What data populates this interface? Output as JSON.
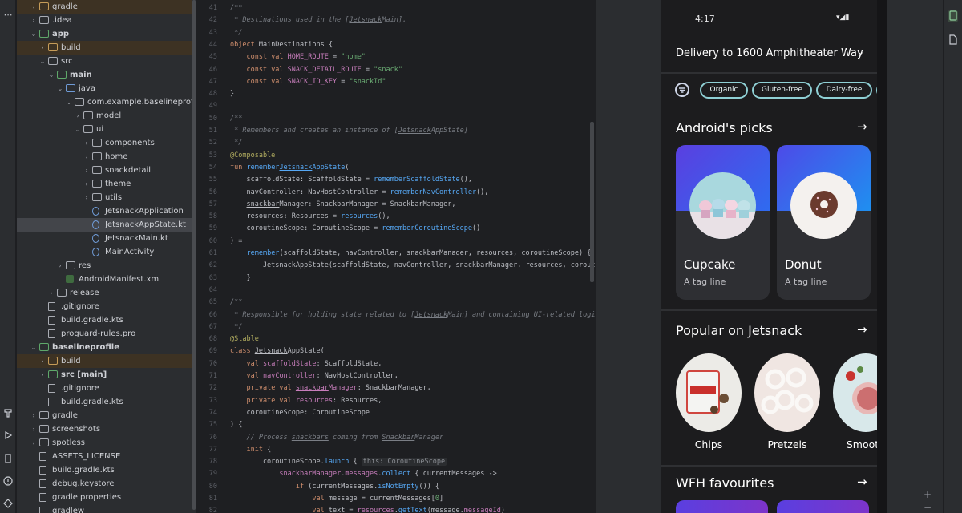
{
  "left_toolbar": {
    "more_label": "⋯",
    "icons": [
      "build-icon",
      "run-icon",
      "device-icon",
      "problems-icon",
      "git-icon"
    ]
  },
  "project_tree": {
    "items": [
      {
        "label": "gradle",
        "depth": 1,
        "chevron": "›",
        "icon": "folder-orange",
        "style": "excluded"
      },
      {
        "label": ".idea",
        "depth": 1,
        "chevron": "›",
        "icon": "folder"
      },
      {
        "label": "app",
        "depth": 1,
        "chevron": "⌄",
        "icon": "folder-green",
        "bold": true
      },
      {
        "label": "build",
        "depth": 2,
        "chevron": "›",
        "icon": "folder-orange",
        "style": "excluded"
      },
      {
        "label": "src",
        "depth": 2,
        "chevron": "⌄",
        "icon": "folder"
      },
      {
        "label": "main",
        "depth": 3,
        "chevron": "⌄",
        "icon": "folder-green",
        "bold": true
      },
      {
        "label": "java",
        "depth": 4,
        "chevron": "⌄",
        "icon": "folder-blue"
      },
      {
        "label": "com.example.baselineprofiles_codel",
        "depth": 5,
        "chevron": "⌄",
        "icon": "folder"
      },
      {
        "label": "model",
        "depth": 6,
        "chevron": "›",
        "icon": "folder"
      },
      {
        "label": "ui",
        "depth": 6,
        "chevron": "⌄",
        "icon": "folder"
      },
      {
        "label": "components",
        "depth": 7,
        "chevron": "›",
        "icon": "folder"
      },
      {
        "label": "home",
        "depth": 7,
        "chevron": "›",
        "icon": "folder"
      },
      {
        "label": "snackdetail",
        "depth": 7,
        "chevron": "›",
        "icon": "folder"
      },
      {
        "label": "theme",
        "depth": 7,
        "chevron": "›",
        "icon": "folder"
      },
      {
        "label": "utils",
        "depth": 7,
        "chevron": "›",
        "icon": "folder"
      },
      {
        "label": "JetsnackApplication",
        "depth": 7,
        "chevron": "",
        "icon": "kt"
      },
      {
        "label": "JetsnackAppState.kt",
        "depth": 7,
        "chevron": "",
        "icon": "kt",
        "style": "selected"
      },
      {
        "label": "JetsnackMain.kt",
        "depth": 7,
        "chevron": "",
        "icon": "kt"
      },
      {
        "label": "MainActivity",
        "depth": 7,
        "chevron": "",
        "icon": "kt"
      },
      {
        "label": "res",
        "depth": 4,
        "chevron": "›",
        "icon": "folder"
      },
      {
        "label": "AndroidManifest.xml",
        "depth": 4,
        "chevron": "",
        "icon": "xml"
      },
      {
        "label": "release",
        "depth": 3,
        "chevron": "›",
        "icon": "folder"
      },
      {
        "label": ".gitignore",
        "depth": 2,
        "chevron": "",
        "icon": "file"
      },
      {
        "label": "build.gradle.kts",
        "depth": 2,
        "chevron": "",
        "icon": "file"
      },
      {
        "label": "proguard-rules.pro",
        "depth": 2,
        "chevron": "",
        "icon": "file"
      },
      {
        "label": "baselineprofile",
        "depth": 1,
        "chevron": "⌄",
        "icon": "folder-green",
        "bold": true
      },
      {
        "label": "build",
        "depth": 2,
        "chevron": "›",
        "icon": "folder-orange",
        "style": "excluded"
      },
      {
        "label": "src [main]",
        "depth": 2,
        "chevron": "›",
        "icon": "folder-green",
        "bold": true
      },
      {
        "label": ".gitignore",
        "depth": 2,
        "chevron": "",
        "icon": "file"
      },
      {
        "label": "build.gradle.kts",
        "depth": 2,
        "chevron": "",
        "icon": "file"
      },
      {
        "label": "gradle",
        "depth": 1,
        "chevron": "›",
        "icon": "folder"
      },
      {
        "label": "screenshots",
        "depth": 1,
        "chevron": "›",
        "icon": "folder"
      },
      {
        "label": "spotless",
        "depth": 1,
        "chevron": "›",
        "icon": "folder"
      },
      {
        "label": "ASSETS_LICENSE",
        "depth": 1,
        "chevron": "",
        "icon": "file"
      },
      {
        "label": "build.gradle.kts",
        "depth": 1,
        "chevron": "",
        "icon": "file"
      },
      {
        "label": "debug.keystore",
        "depth": 1,
        "chevron": "",
        "icon": "file"
      },
      {
        "label": "gradle.properties",
        "depth": 1,
        "chevron": "",
        "icon": "file"
      },
      {
        "label": "gradlew",
        "depth": 1,
        "chevron": "",
        "icon": "file"
      }
    ]
  },
  "editor": {
    "lines": [
      {
        "n": "41",
        "html": "<span class=\"c-com\">/**</span>"
      },
      {
        "n": "42",
        "html": "<span class=\"c-com\"> * Destinations used in the [<span class=\"c-ul\">Jetsnack</span>Main].</span>"
      },
      {
        "n": "43",
        "html": "<span class=\"c-com\"> */</span>"
      },
      {
        "n": "44",
        "html": "<span class=\"c-kw\">object</span> MainDestinations {"
      },
      {
        "n": "45",
        "html": "    <span class=\"c-kw\">const val</span> <span class=\"c-prop\">HOME_ROUTE</span> = <span class=\"c-str\">\"home\"</span>"
      },
      {
        "n": "46",
        "html": "    <span class=\"c-kw\">const val</span> <span class=\"c-prop\">SNACK_DETAIL_ROUTE</span> = <span class=\"c-str\">\"snack\"</span>"
      },
      {
        "n": "47",
        "html": "    <span class=\"c-kw\">const val</span> <span class=\"c-prop\">SNACK_ID_KEY</span> = <span class=\"c-str\">\"snackId\"</span>"
      },
      {
        "n": "48",
        "html": "}"
      },
      {
        "n": "49",
        "html": ""
      },
      {
        "n": "50",
        "html": "<span class=\"c-com\">/**</span>"
      },
      {
        "n": "51",
        "html": "<span class=\"c-com\"> * Remembers and creates an instance of [<span class=\"c-ul\">Jetsnack</span>AppState]</span>"
      },
      {
        "n": "52",
        "html": "<span class=\"c-com\"> */</span>"
      },
      {
        "n": "53",
        "html": "<span class=\"c-ann\">@Composable</span>"
      },
      {
        "n": "54",
        "html": "<span class=\"c-kw\">fun</span> <span class=\"c-fn\">remember<span class=\"c-ul\">Jetsnack</span>AppState</span>("
      },
      {
        "n": "55",
        "html": "    scaffoldState: ScaffoldState = <span class=\"c-fn\">rememberScaffoldState</span>(),"
      },
      {
        "n": "56",
        "html": "    navController: NavHostController = <span class=\"c-fn\">rememberNavController</span>(),"
      },
      {
        "n": "57",
        "html": "    <span class=\"c-ul\">snackbar</span>Manager: SnackbarManager = SnackbarManager,"
      },
      {
        "n": "58",
        "html": "    resources: Resources = <span class=\"c-fn\">resources</span>(),"
      },
      {
        "n": "59",
        "html": "    coroutineScope: CoroutineScope = <span class=\"c-fn\">rememberCoroutineScope</span>()"
      },
      {
        "n": "60",
        "html": ") ="
      },
      {
        "n": "61",
        "html": "    <span class=\"c-fn\">remember</span>(scaffoldState, navController, snackbarManager, resources, coroutineScope) {"
      },
      {
        "n": "62",
        "html": "        JetsnackAppState(scaffoldState, navController, snackbarManager, resources, coroutineScope"
      },
      {
        "n": "63",
        "html": "    }"
      },
      {
        "n": "64",
        "html": ""
      },
      {
        "n": "65",
        "html": "<span class=\"c-com\">/**</span>"
      },
      {
        "n": "66",
        "html": "<span class=\"c-com\"> * Responsible for holding state related to [<span class=\"c-ul\">Jetsnack</span>Main] and containing UI-related logic.</span>"
      },
      {
        "n": "67",
        "html": "<span class=\"c-com\"> */</span>"
      },
      {
        "n": "68",
        "html": "<span class=\"c-ann\">@Stable</span>"
      },
      {
        "n": "69",
        "html": "<span class=\"c-kw\">class</span> <span class=\"c-ul\">Jetsnack</span>AppState("
      },
      {
        "n": "70",
        "html": "    <span class=\"c-kw\">val</span> <span class=\"c-prop\">scaffoldState</span>: ScaffoldState,"
      },
      {
        "n": "71",
        "html": "    <span class=\"c-kw\">val</span> <span class=\"c-prop\">navController</span>: NavHostController,"
      },
      {
        "n": "72",
        "html": "    <span class=\"c-kw\">private val</span> <span class=\"c-prop\"><span class=\"c-ul\">snackbar</span>Manager</span>: SnackbarManager,"
      },
      {
        "n": "73",
        "html": "    <span class=\"c-kw\">private val</span> <span class=\"c-prop\">resources</span>: Resources,"
      },
      {
        "n": "74",
        "html": "    coroutineScope: CoroutineScope"
      },
      {
        "n": "75",
        "html": ") {"
      },
      {
        "n": "76",
        "html": "    <span class=\"c-com\">// Process <span class=\"c-ul\">snackbars</span> coming from <span class=\"c-ul\">Snackbar</span>Manager</span>"
      },
      {
        "n": "77",
        "html": "    <span class=\"c-kw\">init</span> {"
      },
      {
        "n": "78",
        "html": "        coroutineScope.<span class=\"c-fn\">launch</span> { <span class=\"c-hint\">this: CoroutineScope</span>"
      },
      {
        "n": "79",
        "html": "            <span class=\"c-prop\">snackbarManager</span>.<span class=\"c-prop\">messages</span>.<span class=\"c-fn\">collect</span> { currentMessages ->"
      },
      {
        "n": "80",
        "html": "                <span class=\"c-kw\">if</span> (currentMessages.<span class=\"c-fn\">isNotEmpty</span>()) {"
      },
      {
        "n": "81",
        "html": "                    <span class=\"c-kw\">val</span> message = currentMessages[<span class=\"c-str\">0</span>]"
      },
      {
        "n": "82",
        "html": "                    <span class=\"c-kw\">val</span> text = <span class=\"c-prop\">resources</span>.<span class=\"c-fn\">getText</span>(message.<span class=\"c-prop\">messageId</span>)"
      }
    ]
  },
  "phone": {
    "status_time": "4:17",
    "status_icons": "▾◢▮",
    "delivery_label": "Delivery to 1600 Amphitheater Way",
    "delivery_chevron": "⌄",
    "filters": [
      "Organic",
      "Gluten-free",
      "Dairy-free"
    ],
    "sections": [
      {
        "title": "Android's picks",
        "arrow": "→"
      },
      {
        "title": "Popular on Jetsnack",
        "arrow": "→"
      },
      {
        "title": "WFH favourites",
        "arrow": "→"
      }
    ],
    "picks": [
      {
        "name": "Cupcake",
        "tagline": "A tag line"
      },
      {
        "name": "Donut",
        "tagline": "A tag line"
      }
    ],
    "popular": [
      {
        "name": "Chips"
      },
      {
        "name": "Pretzels"
      },
      {
        "name": "Smooth"
      }
    ]
  },
  "right_toolbar": {
    "icons": [
      "running-devices-icon",
      "device-file-icon",
      "device-manager-icon"
    ]
  },
  "emulator_controls": {
    "plus": "+",
    "minus": "−"
  }
}
